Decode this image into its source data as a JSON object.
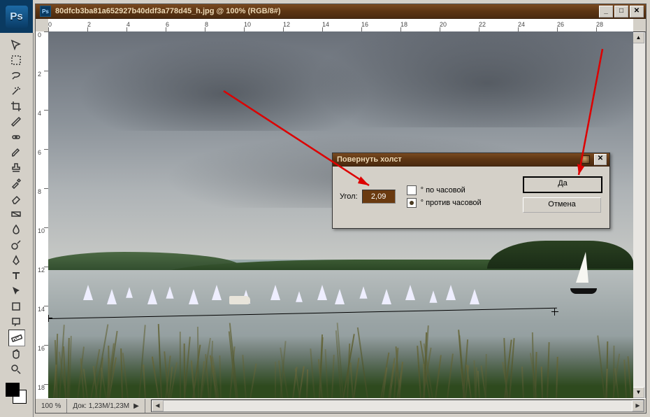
{
  "app": {
    "logo_text": "Ps"
  },
  "doc": {
    "title": "80dfcb3ba81a652927b40ddf3a778d45_h.jpg @ 100% (RGB/8#)",
    "h_ruler": [
      "0",
      "2",
      "4",
      "6",
      "8",
      "10",
      "12",
      "14",
      "16",
      "18",
      "20",
      "22",
      "24",
      "26",
      "28"
    ],
    "v_ruler": [
      "0",
      "2",
      "4",
      "6",
      "8",
      "10",
      "12",
      "14",
      "16",
      "18"
    ],
    "zoom": "100 %",
    "docinfo_label": "Док:",
    "docinfo_value": "1,23M/1,23M"
  },
  "tools": [
    "move",
    "rect-marquee",
    "lasso",
    "wand",
    "crop",
    "slice",
    "heal",
    "brush",
    "stamp",
    "history-brush",
    "eraser",
    "gradient",
    "blur",
    "dodge",
    "pen",
    "type",
    "path-select",
    "shape",
    "notes",
    "eyedropper",
    "hand",
    "zoom"
  ],
  "tool_measure_selected_index": 19,
  "dialog": {
    "title": "Повернуть холст",
    "angle_label": "Угол:",
    "angle_value": "2,09",
    "radio_cw": "° по часовой",
    "radio_ccw": "° против часовой",
    "radio_selected": "ccw",
    "btn_ok": "Да",
    "btn_cancel": "Отмена"
  },
  "colors": {
    "accent": "#5c3513",
    "arrow": "#d00000"
  }
}
